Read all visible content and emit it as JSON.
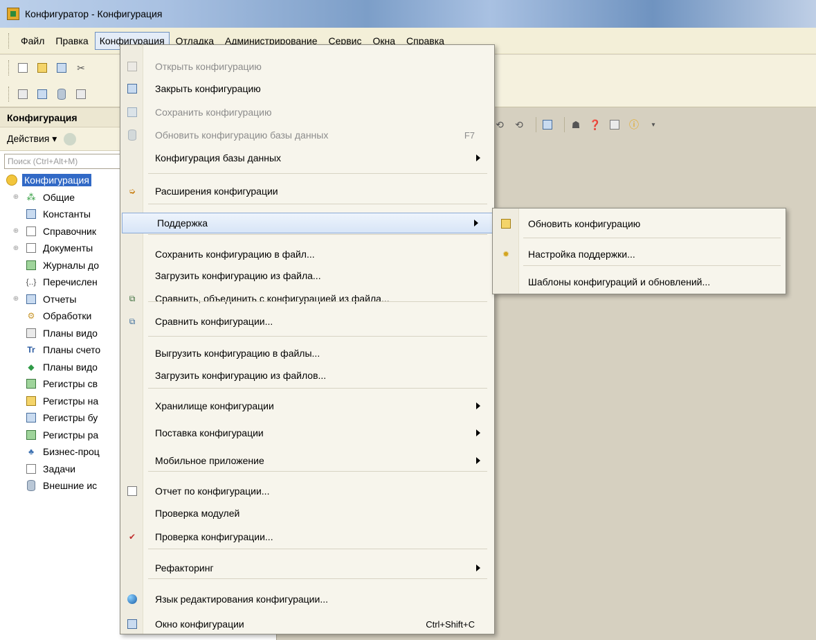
{
  "window": {
    "title": "Конфигуратор - Конфигурация"
  },
  "menubar": {
    "items": [
      "Файл",
      "Правка",
      "Конфигурация",
      "Отладка",
      "Администрирование",
      "Сервис",
      "Окна",
      "Справка"
    ],
    "active": "Конфигурация"
  },
  "left_panel": {
    "header": "Конфигурация",
    "actions_label": "Действия ▾",
    "search_placeholder": "Поиск (Ctrl+Alt+M)",
    "tree": [
      {
        "label": "Конфигурация",
        "icon": "config-root-icon",
        "expander": ""
      },
      {
        "label": "Общие",
        "icon": "common-icon",
        "expander": "⊕"
      },
      {
        "label": "Константы",
        "icon": "constants-icon",
        "expander": ""
      },
      {
        "label": "Справочник",
        "icon": "catalog-icon",
        "expander": "⊕"
      },
      {
        "label": "Документы",
        "icon": "documents-icon",
        "expander": "⊕"
      },
      {
        "label": "Журналы до",
        "icon": "journals-icon",
        "expander": ""
      },
      {
        "label": "Перечислен",
        "icon": "enum-icon",
        "expander": ""
      },
      {
        "label": "Отчеты",
        "icon": "reports-icon",
        "expander": "⊕"
      },
      {
        "label": "Обработки",
        "icon": "processing-icon",
        "expander": ""
      },
      {
        "label": "Планы видо",
        "icon": "plans-icon",
        "expander": ""
      },
      {
        "label": "Планы счето",
        "icon": "accounts-icon",
        "expander": ""
      },
      {
        "label": "Планы видо",
        "icon": "calc-plans-icon",
        "expander": ""
      },
      {
        "label": "Регистры св",
        "icon": "info-registers-icon",
        "expander": ""
      },
      {
        "label": "Регистры на",
        "icon": "accum-registers-icon",
        "expander": ""
      },
      {
        "label": "Регистры бу",
        "icon": "accounting-registers-icon",
        "expander": ""
      },
      {
        "label": "Регистры ра",
        "icon": "calc-registers-icon",
        "expander": ""
      },
      {
        "label": "Бизнес-проц",
        "icon": "business-process-icon",
        "expander": ""
      },
      {
        "label": "Задачи",
        "icon": "tasks-icon",
        "expander": ""
      },
      {
        "label": "Внешние ис",
        "icon": "external-sources-icon",
        "expander": ""
      }
    ]
  },
  "dropdown": {
    "items": [
      {
        "label": "Открыть конфигурацию",
        "disabled": true,
        "icon": "open-config-icon"
      },
      {
        "label": "Закрыть конфигурацию",
        "disabled": false,
        "icon": "close-config-icon"
      },
      {
        "label": "Сохранить конфигурацию",
        "disabled": true,
        "icon": "save-config-icon"
      },
      {
        "label": "Обновить конфигурацию базы данных",
        "disabled": true,
        "icon": "update-db-icon",
        "shortcut": "F7"
      },
      {
        "label": "Конфигурация базы данных",
        "disabled": false,
        "submenu": true
      },
      {
        "label": "Расширения конфигурации",
        "disabled": false,
        "icon": "extensions-icon"
      },
      {
        "label": "Поддержка",
        "disabled": false,
        "submenu": true,
        "highlight": true
      },
      {
        "label": "Сохранить конфигурацию в файл...",
        "disabled": false
      },
      {
        "label": "Загрузить конфигурацию из файла...",
        "disabled": false
      },
      {
        "label": "Сравнить, объединить с конфигурацией из файла...",
        "disabled": false,
        "icon": "compare-merge-icon"
      },
      {
        "label": "Сравнить конфигурации...",
        "disabled": false,
        "icon": "compare-icon"
      },
      {
        "label": "Выгрузить конфигурацию в файлы...",
        "disabled": false
      },
      {
        "label": "Загрузить конфигурацию из файлов...",
        "disabled": false
      },
      {
        "label": "Хранилище конфигурации",
        "disabled": false,
        "submenu": true
      },
      {
        "label": "Поставка конфигурации",
        "disabled": false,
        "submenu": true
      },
      {
        "label": "Мобильное приложение",
        "disabled": false,
        "submenu": true
      },
      {
        "label": "Отчет по конфигурации...",
        "disabled": false,
        "icon": "report-icon"
      },
      {
        "label": "Проверка модулей",
        "disabled": false
      },
      {
        "label": "Проверка конфигурации...",
        "disabled": false,
        "icon": "check-config-icon"
      },
      {
        "label": "Рефакторинг",
        "disabled": false,
        "submenu": true
      },
      {
        "label": "Язык редактирования конфигурации...",
        "disabled": false,
        "icon": "language-icon"
      },
      {
        "label": "Окно конфигурации",
        "disabled": false,
        "icon": "config-window-icon",
        "shortcut": "Ctrl+Shift+C"
      }
    ]
  },
  "submenu": {
    "items": [
      {
        "label": "Обновить конфигурацию",
        "icon": "update-config-icon"
      },
      {
        "label": "Настройка поддержки...",
        "icon": "support-settings-icon"
      },
      {
        "label": "Шаблоны конфигураций и обновлений...",
        "icon": ""
      }
    ]
  },
  "colors": {
    "menu_bg": "#f7f5ec",
    "highlight": "#d7e5f7",
    "selection": "#3169c6",
    "workspace": "#d6d0c0"
  }
}
